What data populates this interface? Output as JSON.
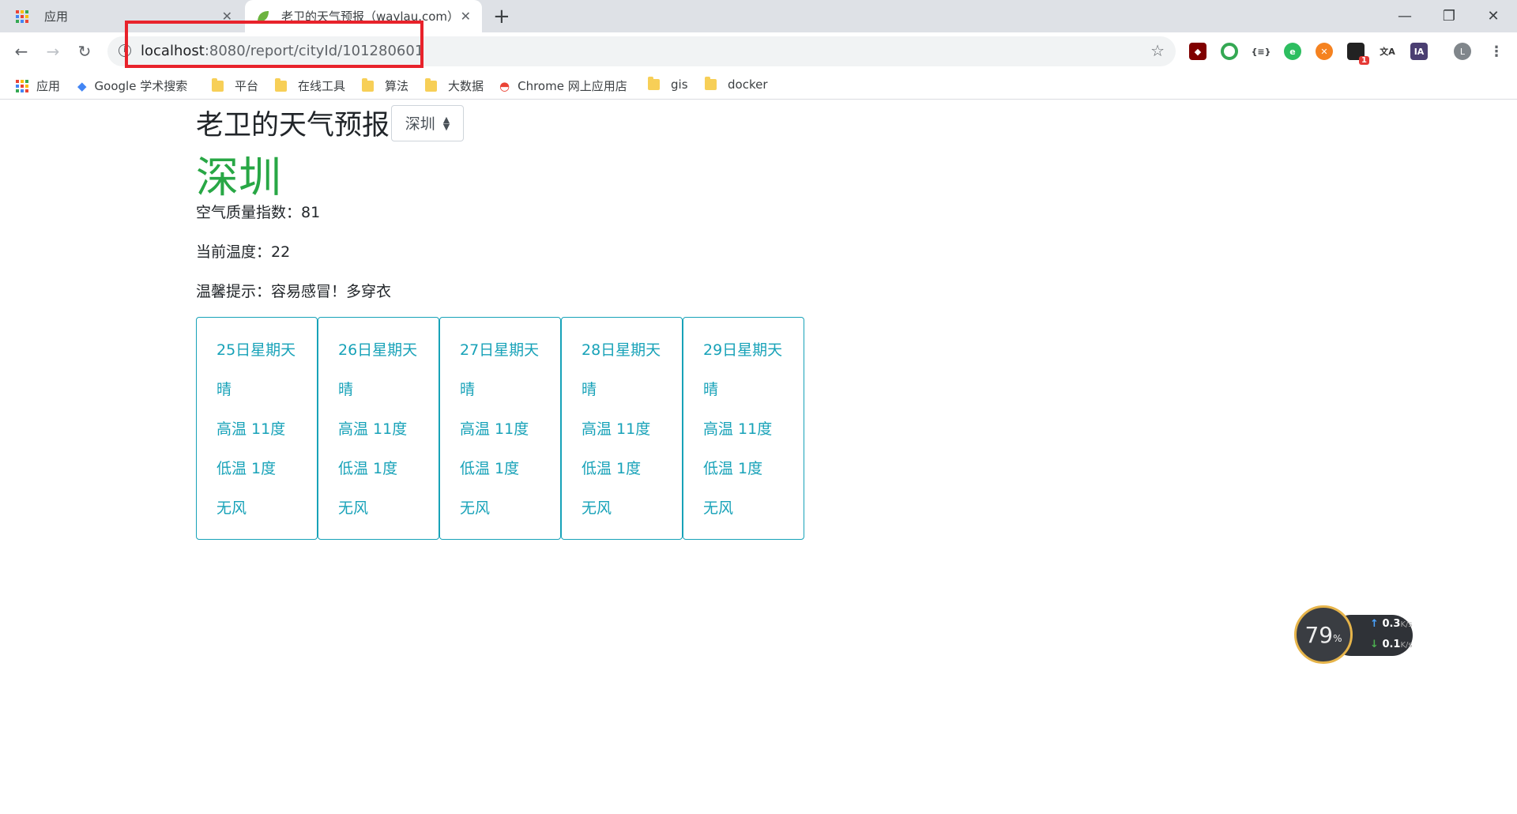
{
  "browser": {
    "tabs": [
      {
        "label": "应用",
        "icon": "apps-grid-icon"
      },
      {
        "label": "老卫的天气预报（waylau.com）",
        "icon": "leaf-icon",
        "active": true
      }
    ],
    "url_host": "localhost",
    "url_rest": ":8080/report/cityId/101280601",
    "bookmarks": [
      {
        "label": "应用",
        "icon": "apps-grid-icon"
      },
      {
        "label": "Google 学术搜索",
        "icon": "scholar-icon"
      },
      {
        "label": "平台",
        "icon": "folder-icon"
      },
      {
        "label": "在线工具",
        "icon": "folder-icon"
      },
      {
        "label": "算法",
        "icon": "folder-icon"
      },
      {
        "label": "大数据",
        "icon": "folder-icon"
      },
      {
        "label": "Chrome 网上应用店",
        "icon": "webstore-icon"
      },
      {
        "label": "gis",
        "icon": "folder-icon"
      },
      {
        "label": "docker",
        "icon": "folder-icon"
      }
    ],
    "profile_initial": "L",
    "ext_badge": "1"
  },
  "page": {
    "title": "老卫的天气预报",
    "selected_city": "深圳",
    "city_name": "深圳",
    "aqi_text": "空气质量指数：81",
    "temp_text": "当前温度：22",
    "tip_text": "温馨提示：容易感冒！多穿衣"
  },
  "forecast": [
    {
      "date": "25日星期天",
      "weather": "晴",
      "high": "高温 11度",
      "low": "低温 1度",
      "wind": "无风"
    },
    {
      "date": "26日星期天",
      "weather": "晴",
      "high": "高温 11度",
      "low": "低温 1度",
      "wind": "无风"
    },
    {
      "date": "27日星期天",
      "weather": "晴",
      "high": "高温 11度",
      "low": "低温 1度",
      "wind": "无风"
    },
    {
      "date": "28日星期天",
      "weather": "晴",
      "high": "高温 11度",
      "low": "低温 1度",
      "wind": "无风"
    },
    {
      "date": "29日星期天",
      "weather": "晴",
      "high": "高温 11度",
      "low": "低温 1度",
      "wind": "无风"
    }
  ],
  "speed_widget": {
    "percent": "79",
    "percent_unit": "%",
    "up": "0.3",
    "down": "0.1",
    "unit": "K/s"
  },
  "colors": {
    "accent_green": "#28a745",
    "card_teal": "#17a2b8",
    "highlight_red": "#e8222b"
  }
}
